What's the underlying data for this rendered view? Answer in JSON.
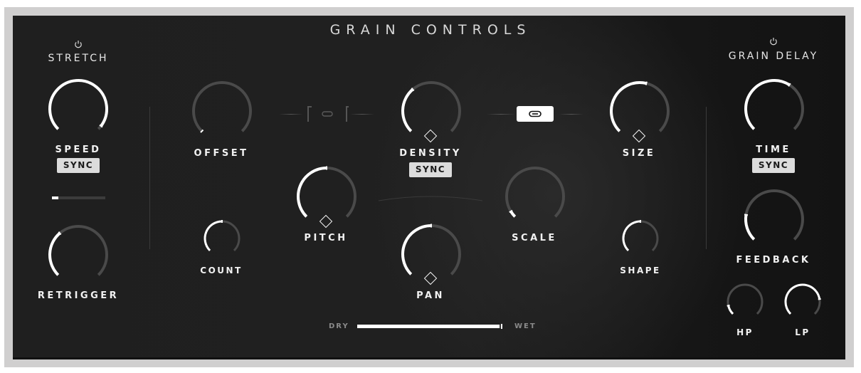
{
  "title": "GRAIN CONTROLS",
  "colors": {
    "active_arc": "#ffffff",
    "inactive_arc": "#4a4a4a",
    "panel_bg": "#1e1e1e",
    "frame": "#d0cfcf"
  },
  "stretch": {
    "title": "STRETCH",
    "power_icon": "power-icon",
    "speed": {
      "label": "SPEED",
      "value": 0.97,
      "sync_label": "SYNC"
    },
    "speed_slider": {
      "value": 0.12
    },
    "retrigger": {
      "label": "RETRIGGER",
      "value": 0.35
    }
  },
  "grain": {
    "offset": {
      "label": "OFFSET",
      "value": 0.0
    },
    "count": {
      "label": "COUNT",
      "value": 0.5
    },
    "density": {
      "label": "DENSITY",
      "value": 0.35,
      "sync_label": "SYNC",
      "modulation_icon": "diamond-icon"
    },
    "size": {
      "label": "SIZE",
      "value": 0.55,
      "modulation_icon": "diamond-icon"
    },
    "pitch": {
      "label": "PITCH",
      "value": 0.5,
      "modulation_icon": "diamond-icon"
    },
    "pan": {
      "label": "PAN",
      "value": 0.5,
      "modulation_icon": "diamond-icon"
    },
    "scale": {
      "label": "SCALE",
      "value": 0.05
    },
    "shape": {
      "label": "SHAPE",
      "value": 0.5
    },
    "link_offset_density": {
      "state": "off",
      "icon": "link-icon"
    },
    "link_density_size": {
      "state": "on",
      "icon": "link-icon"
    }
  },
  "drywet": {
    "dry_label": "DRY",
    "wet_label": "WET",
    "value": 1.0
  },
  "grain_delay": {
    "title": "GRAIN DELAY",
    "power_icon": "power-icon",
    "time": {
      "label": "TIME",
      "value": 0.62,
      "sync_label": "SYNC"
    },
    "feedback": {
      "label": "FEEDBACK",
      "value": 0.2
    },
    "hp": {
      "label": "HP",
      "value": 0.12
    },
    "lp": {
      "label": "LP",
      "value": 0.8
    }
  }
}
